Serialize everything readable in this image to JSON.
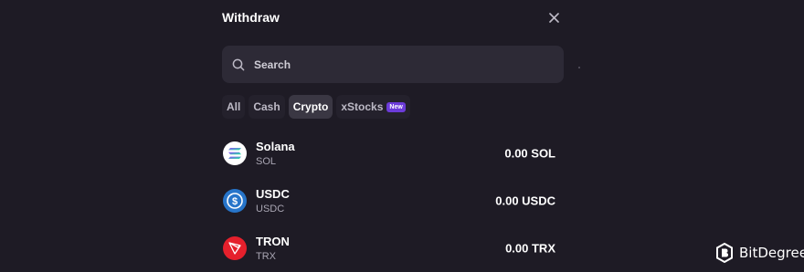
{
  "modal": {
    "title": "Withdraw",
    "close_icon": "close-icon"
  },
  "search": {
    "placeholder": "Search",
    "icon": "search-icon"
  },
  "tabs": [
    {
      "label": "All",
      "active": false
    },
    {
      "label": "Cash",
      "active": false
    },
    {
      "label": "Crypto",
      "active": true
    },
    {
      "label": "xStocks",
      "active": false,
      "badge": "New"
    }
  ],
  "assets": [
    {
      "name": "Solana",
      "symbol": "SOL",
      "amount": "0.00 SOL",
      "icon": "solana-icon"
    },
    {
      "name": "USDC",
      "symbol": "USDC",
      "amount": "0.00 USDC",
      "icon": "usdc-icon"
    },
    {
      "name": "TRON",
      "symbol": "TRX",
      "amount": "0.00 TRX",
      "icon": "tron-icon"
    }
  ],
  "watermark": {
    "name": "BitDegree",
    "icon": "bitdegree-logo-icon"
  },
  "colors": {
    "background": "#1e1b25",
    "search_bg": "#2d2a36",
    "tab_active_bg": "#3a3743",
    "badge_bg": "#6c3bd9",
    "usdc_blue": "#2775ca",
    "tron_red": "#e5202c"
  }
}
